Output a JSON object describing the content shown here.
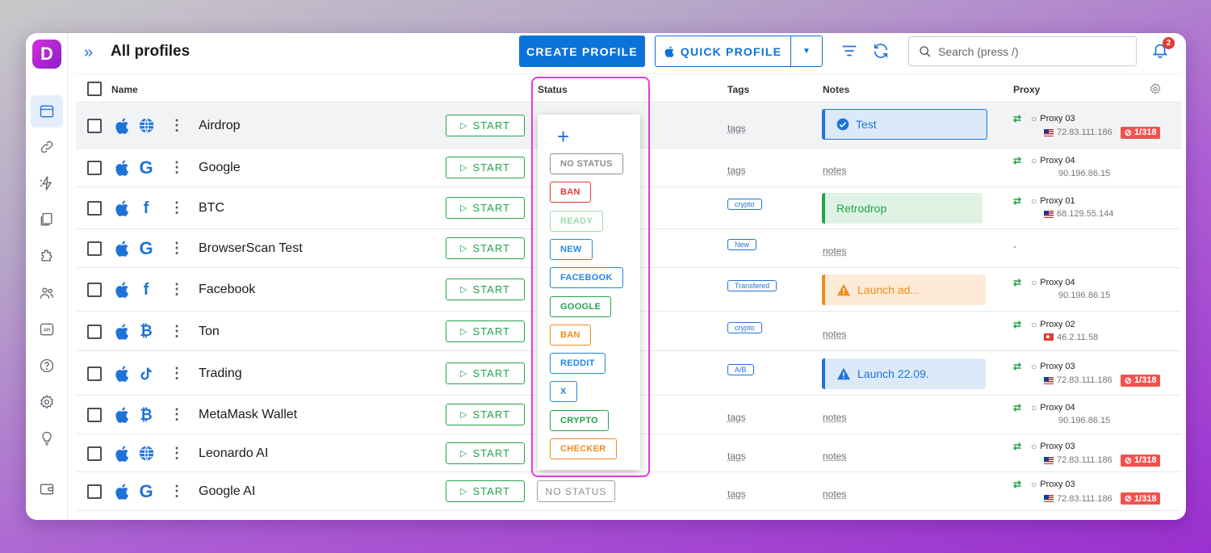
{
  "app": {
    "logo_letter": "D",
    "title": "All profiles"
  },
  "header": {
    "create_label": "CREATE PROFILE",
    "quick_label": "QUICK PROFILE",
    "search_placeholder": "Search (press /)",
    "notifications_count": "2"
  },
  "sidebar": {
    "items": [
      "profiles-icon",
      "link-icon",
      "automation-icon",
      "bookmarks-icon",
      "extensions-icon",
      "team-icon",
      "api-icon",
      "help-icon",
      "settings-icon",
      "ideas-icon",
      "wallet-icon"
    ]
  },
  "columns": {
    "name": "Name",
    "status": "Status",
    "tags": "Tags",
    "notes": "Notes",
    "proxy": "Proxy"
  },
  "start_label": "START",
  "status_dropdown": {
    "options": [
      {
        "label": "NO STATUS",
        "color": "#8a8e95"
      },
      {
        "label": "BAN",
        "color": "#e53935"
      },
      {
        "label": "READY",
        "color": "#9fd8ad"
      },
      {
        "label": "NEW",
        "color": "#1e88e5"
      },
      {
        "label": "FACEBOOK",
        "color": "#1e88e5"
      },
      {
        "label": "GOOGLE",
        "color": "#22a34a"
      },
      {
        "label": "BAN",
        "color": "#f08c1a"
      },
      {
        "label": "REDDIT",
        "color": "#1e88e5"
      },
      {
        "label": "X",
        "color": "#1e88e5"
      },
      {
        "label": "CRYPTO",
        "color": "#22a34a"
      },
      {
        "label": "CHECKER",
        "color": "#f08c1a"
      }
    ]
  },
  "profiles": [
    {
      "name": "Airdrop",
      "browser": "globe-icon",
      "tags": "tags",
      "note": "Test",
      "note_style": "blue-check",
      "proxy": "Proxy 03",
      "ip": "72.83.111.186",
      "flag": "us",
      "blocked": "1/318"
    },
    {
      "name": "Google",
      "browser": "google-icon",
      "tags": "tags",
      "notes": "notes",
      "proxy": "Proxy 04",
      "ip": "90.196.86.15"
    },
    {
      "name": "BTC",
      "browser": "facebook-icon",
      "tag_chip": "crypto",
      "note": "Retrodrop",
      "note_style": "green",
      "proxy": "Proxy 01",
      "ip": "68.129.55.144",
      "flag": "us"
    },
    {
      "name": "BrowserScan Test",
      "browser": "google-icon",
      "tag_chip": "New",
      "notes": "notes",
      "proxy_none": "-"
    },
    {
      "name": "Facebook",
      "browser": "facebook-icon",
      "tag_chip": "Transfered",
      "note": "Launch ad...",
      "note_style": "orange",
      "proxy": "Proxy 04",
      "ip": "90.196.86.15"
    },
    {
      "name": "Ton",
      "browser": "bitcoin-icon",
      "tag_chip": "crypto",
      "notes": "notes",
      "proxy": "Proxy 02",
      "ip": "46.2.11.58",
      "flag": "tr"
    },
    {
      "name": "Trading",
      "browser": "tiktok-icon",
      "tag_chip": "A/B",
      "note": "Launch 22.09.",
      "note_style": "blue-warn",
      "proxy": "Proxy 03",
      "ip": "72.83.111.186",
      "flag": "us",
      "blocked": "1/318"
    },
    {
      "name": "MetaMask Wallet",
      "browser": "bitcoin-icon",
      "tags": "tags",
      "notes": "notes",
      "proxy": "Proxy 04",
      "ip": "90.196.86.15"
    },
    {
      "name": "Leonardo AI",
      "browser": "globe-icon",
      "tags": "tags",
      "notes": "notes",
      "proxy": "Proxy 03",
      "ip": "72.83.111.186",
      "flag": "us",
      "blocked": "1/318"
    },
    {
      "name": "Google AI",
      "browser": "google-icon",
      "status": "NO STATUS",
      "tags": "tags",
      "notes": "notes",
      "proxy": "Proxy 03",
      "ip": "72.83.111.186",
      "flag": "us",
      "blocked": "1/318"
    }
  ]
}
